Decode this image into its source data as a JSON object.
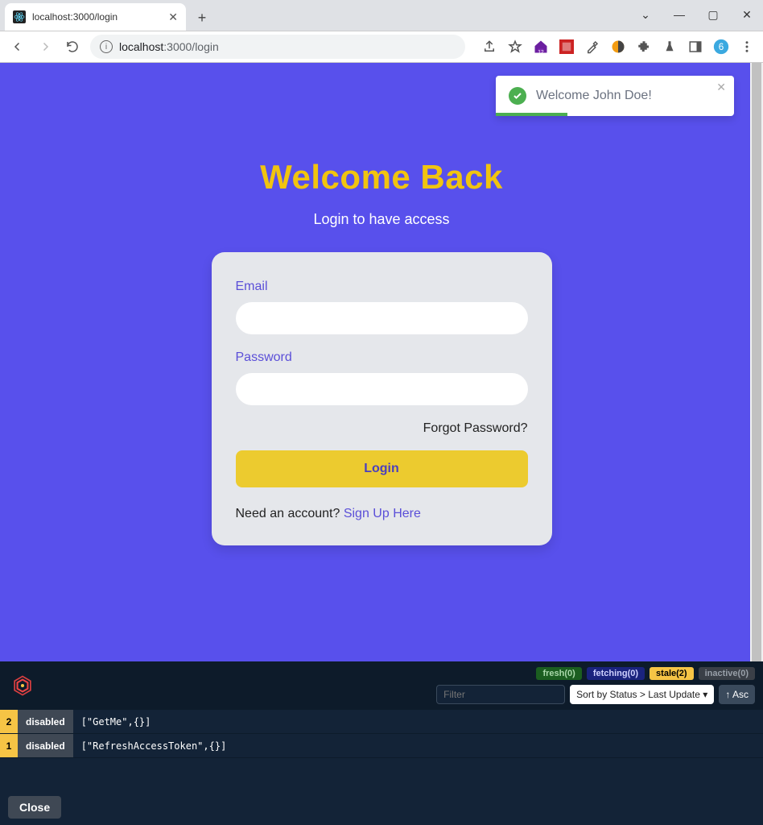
{
  "browser": {
    "tab_title": "localhost:3000/login",
    "url_host": "localhost",
    "url_port_path": ":3000/login"
  },
  "toast": {
    "message": "Welcome John Doe!"
  },
  "login": {
    "title": "Welcome Back",
    "subtitle": "Login to have access",
    "email_label": "Email",
    "password_label": "Password",
    "forgot": "Forgot Password?",
    "login_btn": "Login",
    "need_account": "Need an account? ",
    "signup_link": "Sign Up Here"
  },
  "devtools": {
    "pills": {
      "fresh": "fresh(0)",
      "fetching": "fetching(0)",
      "stale": "stale(2)",
      "inactive": "inactive(0)"
    },
    "filter_placeholder": "Filter",
    "sort_label": "Sort by Status > Last Update",
    "asc_label": "↑ Asc",
    "rows": [
      {
        "count": "2",
        "state": "disabled",
        "key": "[\"GetMe\",{}]"
      },
      {
        "count": "1",
        "state": "disabled",
        "key": "[\"RefreshAccessToken\",{}]"
      }
    ],
    "close": "Close"
  }
}
